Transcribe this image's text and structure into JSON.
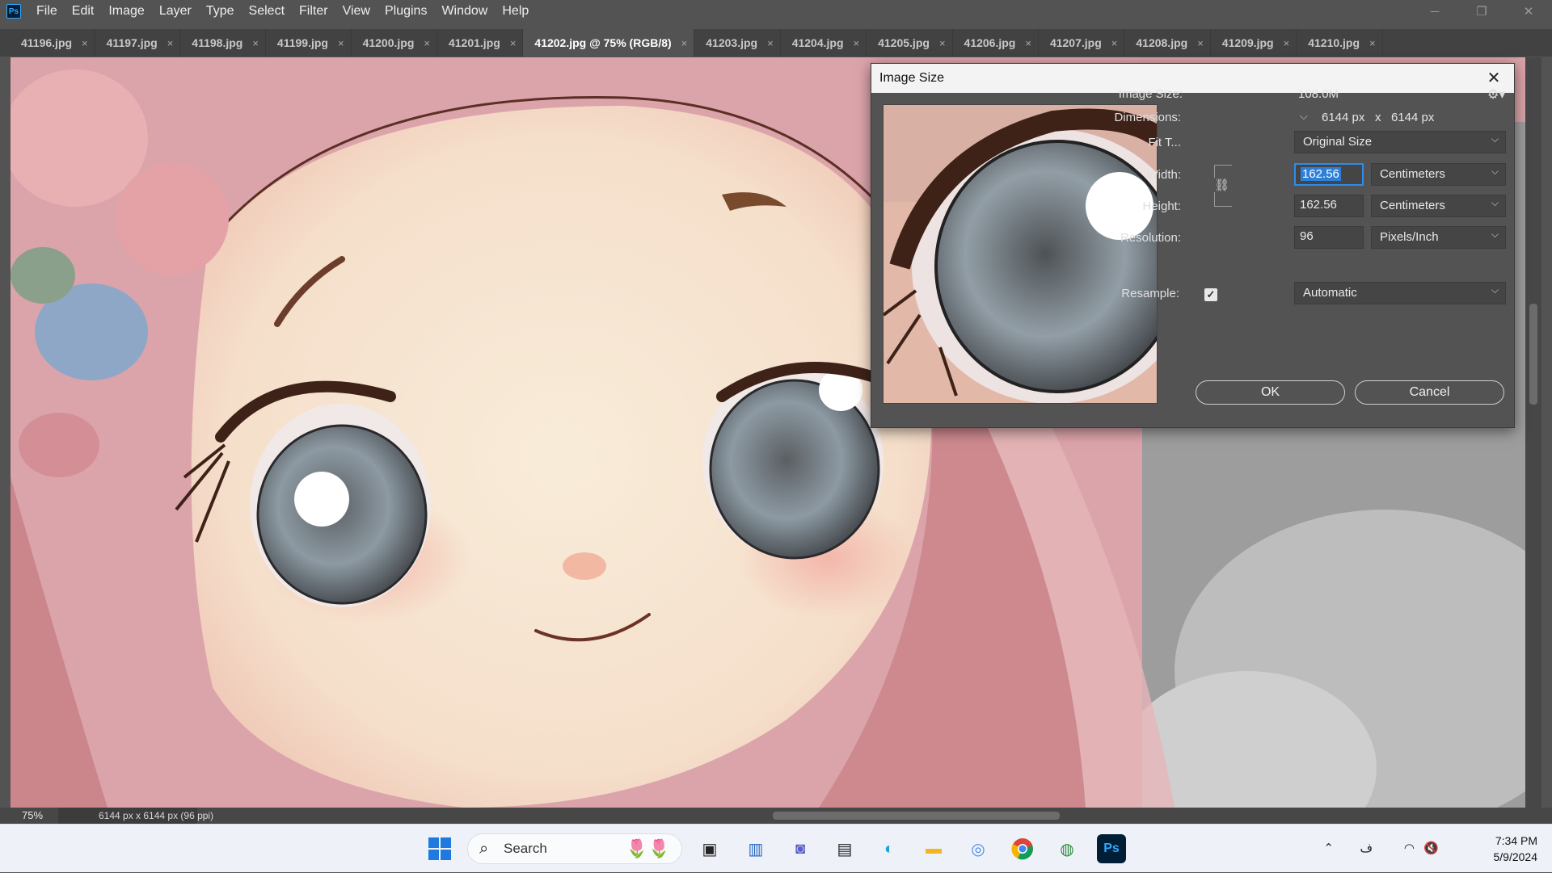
{
  "app": {
    "logo_text": "Ps"
  },
  "menu": [
    "File",
    "Edit",
    "Image",
    "Layer",
    "Type",
    "Select",
    "Filter",
    "View",
    "Plugins",
    "Window",
    "Help"
  ],
  "tabs": [
    {
      "label": "41196.jpg",
      "active": false
    },
    {
      "label": "41197.jpg",
      "active": false
    },
    {
      "label": "41198.jpg",
      "active": false
    },
    {
      "label": "41199.jpg",
      "active": false
    },
    {
      "label": "41200.jpg",
      "active": false
    },
    {
      "label": "41201.jpg",
      "active": false
    },
    {
      "label": "41202.jpg @ 75% (RGB/8)",
      "active": true
    },
    {
      "label": "41203.jpg",
      "active": false
    },
    {
      "label": "41204.jpg",
      "active": false
    },
    {
      "label": "41205.jpg",
      "active": false
    },
    {
      "label": "41206.jpg",
      "active": false
    },
    {
      "label": "41207.jpg",
      "active": false
    },
    {
      "label": "41208.jpg",
      "active": false
    },
    {
      "label": "41209.jpg",
      "active": false
    },
    {
      "label": "41210.jpg",
      "active": false
    }
  ],
  "tab_close_glyph": "×",
  "status": {
    "zoom": "75%",
    "doc_info": "6144 px x 6144 px (96 ppi)"
  },
  "dialog": {
    "title": "Image Size",
    "close_glyph": "✕",
    "image_size_label": "Image Size:",
    "image_size_value": "108.0M",
    "dimensions_label": "Dimensions:",
    "dim_width": "6144 px",
    "dim_x": "x",
    "dim_height": "6144 px",
    "fit_label": "Fit T...",
    "fit_value": "Original Size",
    "width_label": "Width:",
    "width_value": "162.56",
    "width_unit": "Centimeters",
    "height_label": "Height:",
    "height_value": "162.56",
    "height_unit": "Centimeters",
    "resolution_label": "Resolution:",
    "resolution_value": "96",
    "resolution_unit": "Pixels/Inch",
    "resample_label": "Resample:",
    "resample_checked": true,
    "resample_value": "Automatic",
    "ok_label": "OK",
    "cancel_label": "Cancel"
  },
  "taskbar": {
    "search_label": "Search",
    "icons": [
      "windows-start",
      "search",
      "widgets-tulips",
      "task-view",
      "file-explorer-snap",
      "teams-chat",
      "microsoft-store",
      "edge",
      "file-explorer",
      "settings-camera",
      "chrome",
      "earth-app",
      "photoshop"
    ],
    "tray_lang": "ف",
    "time": "7:34 PM",
    "date": "5/9/2024"
  },
  "colors": {
    "ps_blue": "#31a8ff",
    "selection": "#2d7fd8",
    "focus": "#2d8ceb"
  }
}
